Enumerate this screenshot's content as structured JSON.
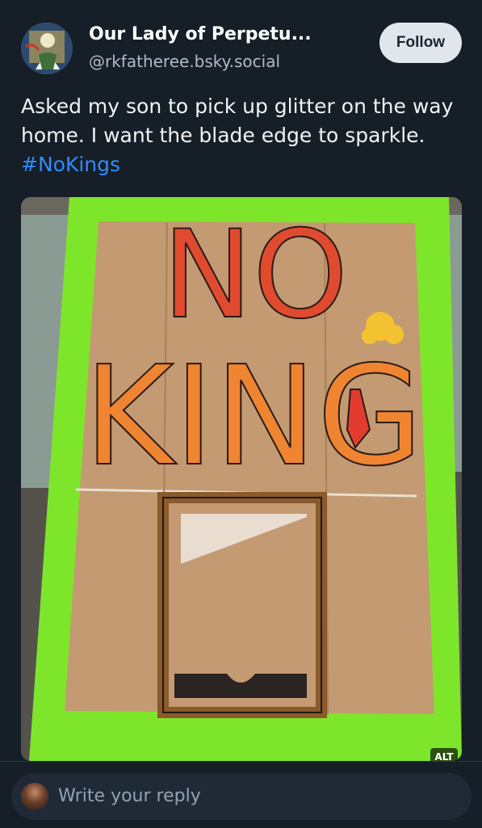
{
  "post": {
    "author_name": "Our Lady of Perpetu...",
    "author_handle": "@rkfatheree.bsky.social",
    "follow_label": "Follow",
    "text_prefix": "Asked my son to pick up glitter on the way home. I want the blade edge to sparkle. ",
    "hashtag": "#NoKings",
    "image": {
      "sign_line1": "NO",
      "sign_line2": "KING",
      "alt_badge": "ALT"
    }
  },
  "reply": {
    "placeholder": "Write your reply"
  },
  "colors": {
    "background": "#161e27",
    "hashtag": "#2f8cff",
    "follow_button": "#e0e6ec",
    "tape_green": "#7ee62a",
    "cardboard": "#c39a72"
  },
  "icons": [
    "avatar-icon",
    "reply-avatar-icon"
  ]
}
